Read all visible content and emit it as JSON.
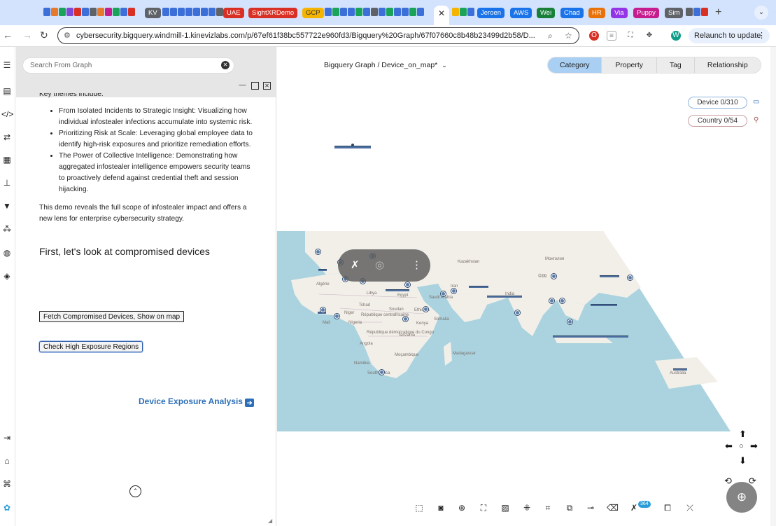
{
  "browser": {
    "tab_groups": [
      {
        "label": "KV",
        "color": "#5f6368"
      },
      {
        "label": "UAE",
        "color": "#d93025"
      },
      {
        "label": "SightXRDemo",
        "color": "#d93025"
      },
      {
        "label": "GCP",
        "color": "#f4b400"
      },
      {
        "label": "Jeroen",
        "color": "#1a73e8"
      },
      {
        "label": "AWS",
        "color": "#1a73e8"
      },
      {
        "label": "Wei",
        "color": "#188038"
      },
      {
        "label": "Chad",
        "color": "#1a73e8"
      },
      {
        "label": "HR",
        "color": "#e8710a"
      },
      {
        "label": "Via",
        "color": "#9334e6"
      },
      {
        "label": "Puppy",
        "color": "#c51d8e"
      },
      {
        "label": "Sim",
        "color": "#5f6368"
      }
    ],
    "url": "cybersecurity.bigquery.windmill-1.kinevizlabs.com/p/67ef61f38bc557722e960fd3/Bigquery%20Graph/67f07660c8b48b23499d2b58/D...",
    "profile_initial": "W",
    "relaunch_label": "Relaunch to update"
  },
  "panel": {
    "search_placeholder": "Search From Graph",
    "intro_cut": "Key themes include:",
    "bullets": [
      "From Isolated Incidents to Strategic Insight: Visualizing how individual infostealer infections accumulate into systemic risk.",
      "Prioritizing Risk at Scale: Leveraging global employee data to identify high-risk exposures and prioritize remediation efforts.",
      "The Power of Collective Intelligence: Demonstrating how aggregated infostealer intelligence empowers security teams to proactively defend against credential theft and session hijacking."
    ],
    "summary": "This demo reveals the full scope of infostealer impact and offers a new lens for enterprise cybersecurity strategy.",
    "heading": "First, let's look at compromised devices",
    "button_fetch": "Fetch Compromised Devices, Show on map",
    "button_check": "Check High Exposure Regions",
    "next_link": "Device Exposure Analysis"
  },
  "graph": {
    "title": "Bigquery Graph / Device_on_map*",
    "tabs": [
      {
        "label": "Category",
        "active": true
      },
      {
        "label": "Property",
        "active": false
      },
      {
        "label": "Tag",
        "active": false
      },
      {
        "label": "Relationship",
        "active": false
      }
    ],
    "legend": [
      {
        "label": "Device 0/310",
        "color": "#2d6fb7"
      },
      {
        "label": "Country 0/54",
        "color": "#a0504a"
      }
    ],
    "badge_count": "364",
    "map_labels": [
      "Algérie",
      "Mali",
      "Niger",
      "Tchad",
      "Nigeria",
      "Soudan",
      "République centrafricaine",
      "Ethiopia",
      "Somalia",
      "Kenya",
      "République démocratique du Congo",
      "Tanzania",
      "Angola",
      "Namibia",
      "Moçambique",
      "South Africa",
      "Madagascar",
      "Kazakhstan",
      "Монголия",
      "中国",
      "India",
      "Iran",
      "Saudi Arabia",
      "Egypt",
      "Libya",
      "Australia"
    ]
  },
  "colors": {
    "accent": "#a9cff3",
    "ocean": "#aad3df",
    "land": "#f2efe9",
    "node": "#5b7da8",
    "link": "#2d6fb7"
  }
}
